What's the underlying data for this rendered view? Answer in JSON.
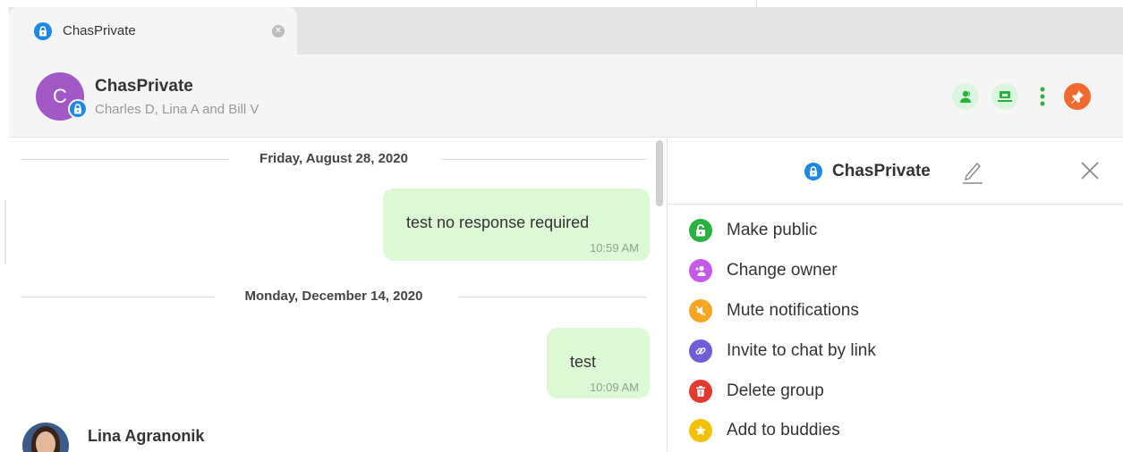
{
  "tab": {
    "label": "ChasPrivate",
    "close_glyph": "✕"
  },
  "header": {
    "avatar_letter": "C",
    "title": "ChasPrivate",
    "subtitle": "Charles D, Lina A and Bill V",
    "actions": [
      "call-icon",
      "screen-share-icon",
      "more-vertical-icon",
      "pin-icon"
    ]
  },
  "chat": {
    "dates": [
      "Friday, August 28, 2020",
      "Monday, December 14, 2020"
    ],
    "messages": [
      {
        "text": "test no response required",
        "time": "10:59 AM"
      },
      {
        "text": "test",
        "time": "10:09 AM"
      }
    ],
    "next_sender": "Lina Agranonik"
  },
  "panel": {
    "title": "ChasPrivate",
    "menu": [
      {
        "label": "Make public",
        "icon": "unlock-icon",
        "color": "#2ab23e"
      },
      {
        "label": "Change owner",
        "icon": "change-owner-icon",
        "color": "#c55ae8"
      },
      {
        "label": "Mute notifications",
        "icon": "mute-icon",
        "color": "#f5a623"
      },
      {
        "label": "Invite to chat by link",
        "icon": "link-icon",
        "color": "#6f5ed8"
      },
      {
        "label": "Delete group",
        "icon": "trash-icon",
        "color": "#e23a2e"
      },
      {
        "label": "Add to buddies",
        "icon": "star-icon",
        "color": "#f2c200"
      }
    ]
  },
  "colors": {
    "accent": "#1e88e5",
    "bubble": "#dcf8d4",
    "avatar": "#a259c6",
    "pin": "#f26a2f"
  }
}
